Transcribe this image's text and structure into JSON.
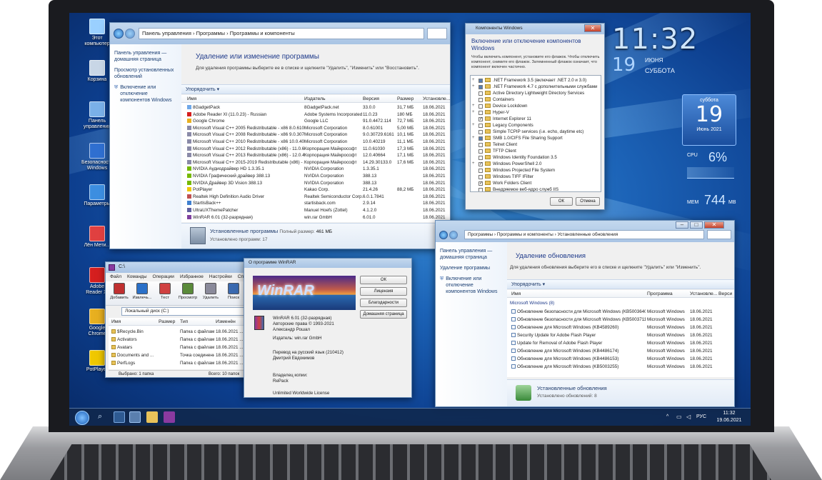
{
  "desktop": {
    "icons": [
      {
        "label": "Этот компьютер",
        "color": "#9ad0ff"
      },
      {
        "label": "Корзина",
        "color": "#c8d6e6"
      },
      {
        "label": "Панель управления",
        "color": "#7ab0e8"
      },
      {
        "label": "Безопасность Windows",
        "color": "#2f6fd0"
      },
      {
        "label": "Параметры",
        "color": "#3c8ee0"
      },
      {
        "label": "Лён Мети...",
        "color": "#e04040"
      },
      {
        "label": "Adobe Reader XI",
        "color": "#d51f1f"
      },
      {
        "label": "Google Chrome",
        "color": "#e8b020"
      },
      {
        "label": "PotPlayer",
        "color": "#f0c800"
      }
    ]
  },
  "gadget": {
    "time": "11:32",
    "day": "19",
    "month": "ИЮНЯ",
    "weekday": "СУББОТА",
    "cal_weekday": "суббота",
    "cal_day": "19",
    "cal_month": "Июнь 2021",
    "cpu_label": "CPU",
    "cpu_value": "6%",
    "mem_label": "МЕМ",
    "mem_value": "744",
    "mem_unit": "MB"
  },
  "programs": {
    "address": "Панель управления › Программы › Программы и компоненты",
    "side_links": [
      "Панель управления — домашняя страница",
      "Просмотр установленных обновлений",
      "Включение или отключение компонентов Windows"
    ],
    "title": "Удаление или изменение программы",
    "desc": "Для удаления программы выберите ее в списке и щелкните \"Удалить\", \"Изменить\" или \"Восстановить\".",
    "organize": "Упорядочить ▾",
    "columns": [
      "Имя",
      "Издатель",
      "Версия",
      "Размер",
      "Установле..."
    ],
    "rows": [
      [
        "8GadgetPack",
        "8GadgetPack.net",
        "33.0.0",
        "31,7 МБ",
        "18.06.2021",
        "#6fa8e8"
      ],
      [
        "Adobe Reader XI (11.0.23) - Russian",
        "Adobe Systems Incorporated",
        "11.0.23",
        "180 МБ",
        "18.06.2021",
        "#d51f1f"
      ],
      [
        "Google Chrome",
        "Google LLC",
        "91.0.4472.114",
        "72,7 МБ",
        "18.06.2021",
        "#e8b020"
      ],
      [
        "Microsoft Visual C++ 2005 Redistributable - x86 8.0.61001",
        "Microsoft Corporation",
        "8.0.61001",
        "5,00 МБ",
        "18.06.2021",
        "#8a8aa8"
      ],
      [
        "Microsoft Visual C++ 2008 Redistributable - x86 9.0.30729.6161",
        "Microsoft Corporation",
        "9.0.30729.6161",
        "10,1 МБ",
        "18.06.2021",
        "#8a8aa8"
      ],
      [
        "Microsoft Visual C++ 2010 Redistributable - x86 10.0.40219",
        "Microsoft Corporation",
        "10.0.40219",
        "11,1 МБ",
        "18.06.2021",
        "#8a8aa8"
      ],
      [
        "Microsoft Visual C++ 2012 Redistributable (x86) - 11.0.61030",
        "Корпорация Майкрософт",
        "11.0.61030",
        "17,3 МБ",
        "18.06.2021",
        "#8a8aa8"
      ],
      [
        "Microsoft Visual C++ 2013 Redistributable (x86) - 12.0.40664",
        "Корпорация Майкрософт",
        "12.0.40664",
        "17,1 МБ",
        "18.06.2021",
        "#8a8aa8"
      ],
      [
        "Microsoft Visual C++ 2015-2019 Redistributable (x86) - 14.29...",
        "Корпорация Майкрософт",
        "14.29.30133.0",
        "17,6 МБ",
        "18.06.2021",
        "#8a8aa8"
      ],
      [
        "NVIDIA Аудиодрайвер HD 1.3.35.1",
        "NVIDIA Corporation",
        "1.3.35.1",
        "",
        "18.06.2021",
        "#76b900"
      ],
      [
        "NVIDIA Графический драйвер 388.13",
        "NVIDIA Corporation",
        "388.13",
        "",
        "18.06.2021",
        "#76b900"
      ],
      [
        "NVIDIA Драйвер 3D Vision 388.13",
        "NVIDIA Corporation",
        "388.13",
        "",
        "18.06.2021",
        "#76b900"
      ],
      [
        "PotPlayer",
        "Kakao Corp.",
        "21.4.26",
        "88,2 МБ",
        "18.06.2021",
        "#f0c800"
      ],
      [
        "Realtek High Definition Audio Driver",
        "Realtek Semiconductor Corp.",
        "6.0.1.7841",
        "",
        "18.06.2021",
        "#c05050"
      ],
      [
        "StartIsBack++",
        "startisback.com",
        "2.9.14",
        "",
        "18.06.2021",
        "#4080d0"
      ],
      [
        "UltraUXThemePatcher",
        "Manuel Hoefs (Zottel)",
        "4.1.2.0",
        "",
        "18.06.2021",
        "#6060a0"
      ],
      [
        "WinRAR 6.01 (32-разрядная)",
        "win.rar GmbH",
        "6.01.0",
        "",
        "18.06.2021",
        "#8040a0"
      ]
    ],
    "footer_title": "Установленные программы",
    "footer_size_label": "Полный размер:",
    "footer_size": "461 МБ",
    "footer_count": "Установлено программ: 17"
  },
  "features": {
    "title": "Компоненты Windows",
    "heading": "Включение или отключение компонентов Windows",
    "desc": "Чтобы включить компонент, установите его флажок. Чтобы отключить компонент, снимите его флажок. Затемненный флажок означает, что компонент включен частично.",
    "items": [
      {
        "label": ".NET Framework 3.5 (включает .NET 2.0 и 3.0)",
        "state": "partial",
        "expand": "+"
      },
      {
        "label": ".NET Framework 4.7 с дополнительными службами",
        "state": "partial",
        "expand": "+"
      },
      {
        "label": "Active Directory Lightweight Directory Services",
        "state": "off",
        "expand": ""
      },
      {
        "label": "Containers",
        "state": "off",
        "expand": ""
      },
      {
        "label": "Device Lockdown",
        "state": "off",
        "expand": "+"
      },
      {
        "label": "Hyper-V",
        "state": "off",
        "expand": "+"
      },
      {
        "label": "Internet Explorer 11",
        "state": "on",
        "expand": ""
      },
      {
        "label": "Legacy Components",
        "state": "off",
        "expand": "+"
      },
      {
        "label": "Simple TCPIP services (i.e. echo, daytime etc)",
        "state": "off",
        "expand": ""
      },
      {
        "label": "SMB 1.0/CIFS File Sharing Support",
        "state": "partial",
        "expand": "+"
      },
      {
        "label": "Telnet Client",
        "state": "off",
        "expand": ""
      },
      {
        "label": "TFTP Client",
        "state": "off",
        "expand": ""
      },
      {
        "label": "Windows Identity Foundation 3.5",
        "state": "off",
        "expand": ""
      },
      {
        "label": "Windows PowerShell 2.0",
        "state": "on",
        "expand": "+"
      },
      {
        "label": "Windows Projected File System",
        "state": "off",
        "expand": ""
      },
      {
        "label": "Windows TIFF IFilter",
        "state": "off",
        "expand": ""
      },
      {
        "label": "Work Folders Client",
        "state": "on",
        "expand": ""
      },
      {
        "label": "Внедряемое веб-ядро служб IIS",
        "state": "off",
        "expand": ""
      }
    ],
    "ok": "ОК",
    "cancel": "Отмена"
  },
  "updates": {
    "address": "Программы › Программы и компоненты › Установленные обновления",
    "side_links": [
      "Панель управления — домашняя страница",
      "Удаление программы",
      "Включение или отключение компонентов Windows"
    ],
    "title": "Удаление обновления",
    "desc": "Для удаления обновления выберите его в списке и щелкните \"Удалить\" или \"Изменить\".",
    "organize": "Упорядочить ▾",
    "columns": [
      "Имя",
      "Программа",
      "Установле...",
      "Верси"
    ],
    "group": "Microsoft Windows (8)",
    "rows": [
      [
        "Обновление безопасности для Microsoft Windows (KB5003640)",
        "Microsoft Windows",
        "18.06.2021"
      ],
      [
        "Обновление безопасности для Microsoft Windows (KB5003711)",
        "Microsoft Windows",
        "18.06.2021"
      ],
      [
        "Обновление для Microsoft Windows (KB4589260)",
        "Microsoft Windows",
        "18.06.2021"
      ],
      [
        "Security Update for Adobe Flash Player",
        "Microsoft Windows",
        "18.06.2021"
      ],
      [
        "Update for Removal of Adobe Flash Player",
        "Microsoft Windows",
        "18.06.2021"
      ],
      [
        "Обновление для Microsoft Windows (KB4486174)",
        "Microsoft Windows",
        "18.06.2021"
      ],
      [
        "Обновление для Microsoft Windows (KB4486153)",
        "Microsoft Windows",
        "18.06.2021"
      ],
      [
        "Обновление для Microsoft Windows (KB5003255)",
        "Microsoft Windows",
        "18.06.2021"
      ]
    ],
    "footer_title": "Установленные обновления",
    "footer_count": "Установлено обновлений: 8"
  },
  "winrar": {
    "title": "C:\\",
    "menu": [
      "Файл",
      "Команды",
      "Операции",
      "Избранное",
      "Настройки",
      "Справка"
    ],
    "tools": [
      {
        "label": "Добавить",
        "color": "#c03030"
      },
      {
        "label": "Извлечь...",
        "color": "#2a70c8"
      },
      {
        "label": "Тест",
        "color": "#d04040"
      },
      {
        "label": "Просмотр",
        "color": "#5a8a3a"
      },
      {
        "label": "Удалить",
        "color": "#8a8a9a"
      },
      {
        "label": "Поиск",
        "color": "#3a6ab0"
      }
    ],
    "path": "Локальный диск (C:)",
    "columns": [
      "Имя",
      "Размер",
      "Тип",
      "Изменён"
    ],
    "rows": [
      [
        "$Recycle.Bin",
        "",
        "Папка с файлами",
        "18.06.2021 ..."
      ],
      [
        "Activators",
        "",
        "Папка с файлами",
        "18.06.2021 ..."
      ],
      [
        "Avatars",
        "",
        "Папка с файлами",
        "18.06.2021 ..."
      ],
      [
        "Documents and ...",
        "",
        "Точка соединения",
        "18.06.2021 ..."
      ],
      [
        "PerfLogs",
        "",
        "Папка с файлами",
        "18.06.2021 ..."
      ]
    ],
    "status": "Выбрано: 1 папка",
    "status_right": "Всего: 10 папок"
  },
  "about": {
    "title": "О программе WinRAR",
    "logo_text": "WinRAR",
    "product": "WinRAR 6.01 (32-разрядная)",
    "copyright": "Авторские права © 1993-2021",
    "author": "Александр Рошал",
    "publisher": "Издатель: win.rar GmbH",
    "translation": "Перевод на русский язык (210412)",
    "translator": "Дмитрий Евдокимов",
    "owner_label": "Владелец копии:",
    "owner": "RePack",
    "license": "Unlimited Worldwide License",
    "buttons": [
      "ОК",
      "Лицензия",
      "Благодарности",
      "Домашняя страница"
    ]
  },
  "taskbar": {
    "lang": "РУС",
    "time": "11:32",
    "date": "19.06.2021"
  }
}
